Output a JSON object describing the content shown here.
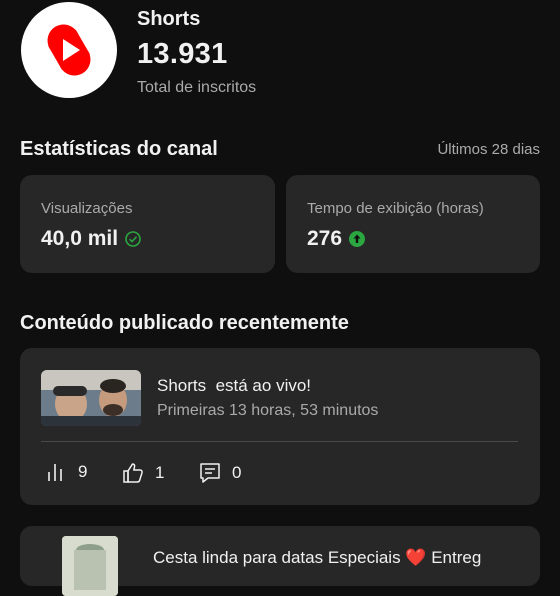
{
  "channel": {
    "name": "Shorts",
    "subscriber_count": "13.931",
    "subscriber_label": "Total de inscritos",
    "brand_color": "#ff0000"
  },
  "stats": {
    "title": "Estatísticas do canal",
    "period": "Últimos 28 dias",
    "cards": [
      {
        "label": "Visualizações",
        "value": "40,0 mil",
        "icon": "check-circle-icon",
        "icon_color": "#2ba640"
      },
      {
        "label": "Tempo de exibição (horas)",
        "value": "276",
        "icon": "arrow-up-circle-icon",
        "icon_color": "#2ba640"
      }
    ]
  },
  "recent": {
    "title": "Conteúdo publicado recentemente",
    "items": [
      {
        "title": "Shorts  está ao vivo!",
        "subtitle": "Primeiras 13 horas, 53 minutos",
        "metrics": {
          "views": "9",
          "likes": "1",
          "comments": "0"
        }
      },
      {
        "title": "Cesta linda para datas Especiais ❤️ Entreg"
      }
    ]
  }
}
